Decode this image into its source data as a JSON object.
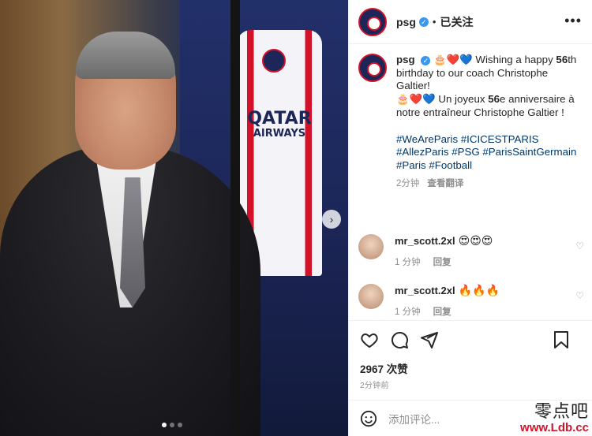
{
  "header": {
    "username": "psg",
    "follow_state": "已关注",
    "more_label": "•••"
  },
  "caption": {
    "username": "psg",
    "emoji_prefix": "🎂❤️💙",
    "line1_pre": " Wishing a happy ",
    "line1_bold": "56",
    "line1_post": "th birthday to our coach Christophe Galtier!",
    "line2_emoji": "🎂❤️💙",
    "line2_pre": " Un joyeux ",
    "line2_bold": "56",
    "line2_post": "e anniversaire à notre entraîneur Christophe Galtier !",
    "hashtags": "#WeAreParis #ICICESTPARIS #AllezParis #PSG #ParisSaintGermain #Paris #Football",
    "time": "2分钟",
    "translate": "查看翻译"
  },
  "comments": [
    {
      "username": "mr_scott.2xl",
      "text": "😍😍😍",
      "time": "1 分钟",
      "reply": "回复"
    },
    {
      "username": "mr_scott.2xl",
      "text": "🔥🔥🔥",
      "time": "1 分钟",
      "reply": "回复"
    }
  ],
  "likes": "2967 次赞",
  "post_time": "2分钟前",
  "add_comment_placeholder": "添加评论...",
  "watermark": {
    "line1": "零点吧",
    "line2": "www.Ldb.cc"
  },
  "photo": {
    "jersey_text1": "QATAR",
    "jersey_text2": "AIRWAYS",
    "carousel_index": 0,
    "carousel_total": 3
  },
  "colors": {
    "accent": "#3897f0",
    "hashtag": "#00376b",
    "psg_blue": "#1c2658",
    "psg_red": "#d3122a"
  }
}
